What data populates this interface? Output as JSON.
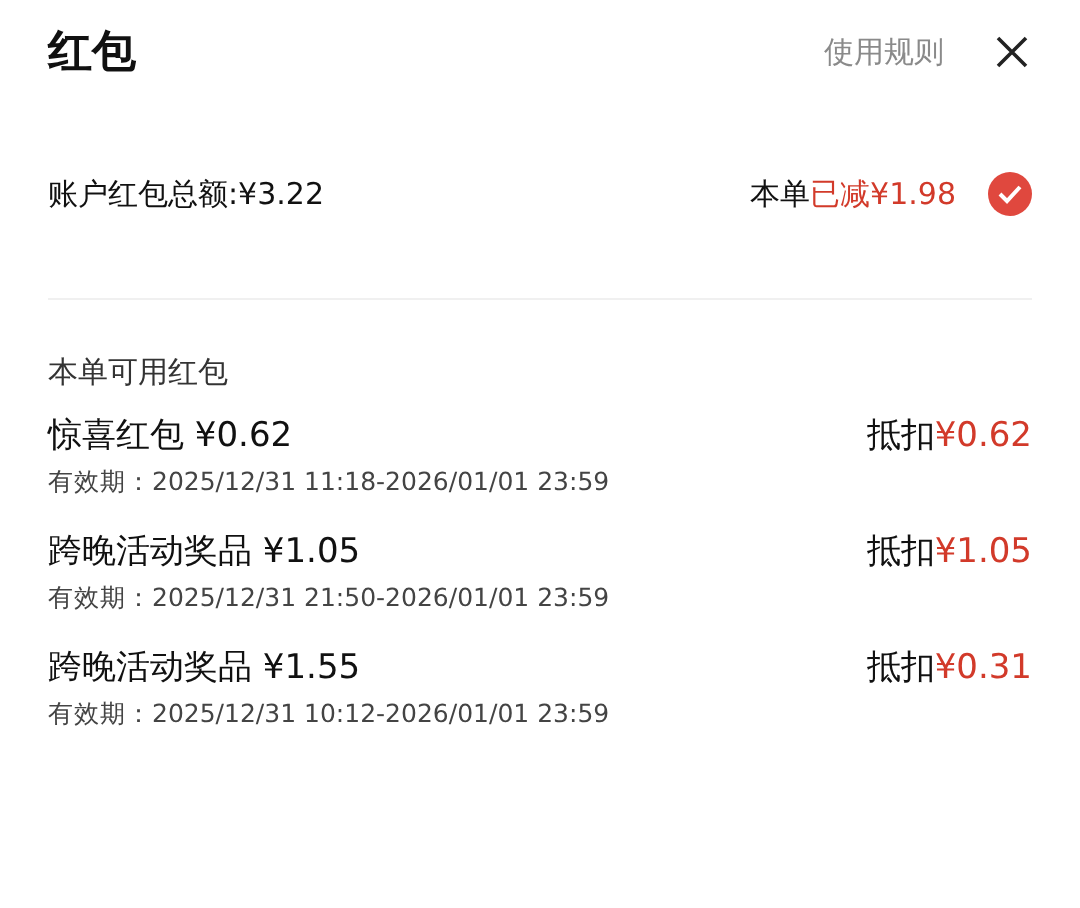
{
  "header": {
    "title": "红包",
    "rules_link": "使用规则"
  },
  "summary": {
    "total": "账户红包总额:¥3.22",
    "prefix": "本单",
    "deducted": "已减¥1.98",
    "checked": true
  },
  "section_title": "本单可用红包",
  "items": [
    {
      "name": "惊喜红包 ¥0.62",
      "validity": "有效期：2025/12/31 11:18-2026/01/01 23:59",
      "deduct_label": "抵扣",
      "deduct_amount": "¥0.62"
    },
    {
      "name": "跨晚活动奖品 ¥1.05",
      "validity": "有效期：2025/12/31 21:50-2026/01/01 23:59",
      "deduct_label": "抵扣",
      "deduct_amount": "¥1.05"
    },
    {
      "name": "跨晚活动奖品 ¥1.55",
      "validity": "有效期：2025/12/31 10:12-2026/01/01 23:59",
      "deduct_label": "抵扣",
      "deduct_amount": "¥0.31"
    }
  ]
}
